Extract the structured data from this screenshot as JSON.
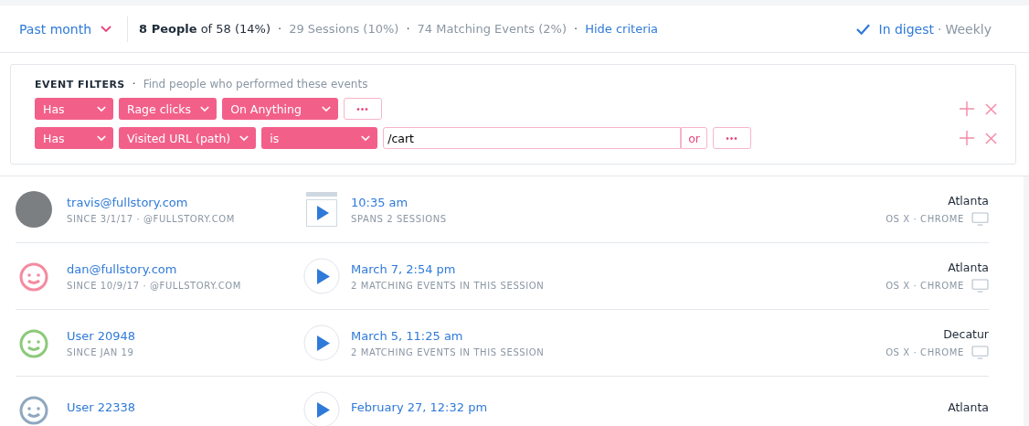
{
  "header": {
    "range": "Past month",
    "summary": [
      {
        "kind": "strong",
        "bold": "8 People",
        "rest": " of 58 (14%)"
      },
      {
        "kind": "muted",
        "text": "29 Sessions (10%)"
      },
      {
        "kind": "muted",
        "text": "74 Matching Events (2%)"
      },
      {
        "kind": "link",
        "text": "Hide criteria"
      }
    ],
    "separator": "·",
    "digest": {
      "checked": true,
      "label": "In digest",
      "sep": "·",
      "frequency": "Weekly"
    }
  },
  "filters": {
    "title": "EVENT FILTERS",
    "sep": "·",
    "subtitle": "Find people who performed these events",
    "rows": [
      {
        "items": [
          {
            "kind": "dropdown",
            "label": "Has"
          },
          {
            "kind": "dropdown",
            "label": "Rage clicks"
          },
          {
            "kind": "dropdown",
            "label": "On Anything"
          },
          {
            "kind": "more",
            "label": "•••"
          }
        ]
      },
      {
        "items": [
          {
            "kind": "dropdown",
            "label": "Has"
          },
          {
            "kind": "dropdown",
            "label": "Visited URL (path)"
          },
          {
            "kind": "dropdown",
            "label": "is"
          },
          {
            "kind": "input",
            "value": "/cart"
          },
          {
            "kind": "or",
            "label": "or"
          },
          {
            "kind": "more",
            "label": "•••"
          }
        ]
      }
    ]
  },
  "people": [
    {
      "avatar": {
        "kind": "photo"
      },
      "name": "travis@fullstory.com",
      "meta": "SINCE 3/1/17 · @FULLSTORY.COM",
      "session": {
        "kind": "clip"
      },
      "time": "10:35 am",
      "detail": "SPANS 2 SESSIONS",
      "city": "Atlanta",
      "device": "OS X · CHROME"
    },
    {
      "avatar": {
        "kind": "face"
      },
      "color": "#f48aa0",
      "name": "dan@fullstory.com",
      "meta": "SINCE 10/9/17 · @FULLSTORY.COM",
      "session": {
        "kind": "play"
      },
      "time": "March 7, 2:54 pm",
      "detail": "2 MATCHING EVENTS IN THIS SESSION",
      "city": "Atlanta",
      "device": "OS X · CHROME"
    },
    {
      "avatar": {
        "kind": "face"
      },
      "color": "#8dc97b",
      "name": "User 20948",
      "meta": "SINCE JAN 19",
      "session": {
        "kind": "play"
      },
      "time": "March 5, 11:25 am",
      "detail": "2 MATCHING EVENTS IN THIS SESSION",
      "city": "Decatur",
      "device": "OS X · CHROME"
    },
    {
      "avatar": {
        "kind": "face"
      },
      "color": "#8fa8bf",
      "name": "User 22338",
      "session": {
        "kind": "play"
      },
      "time": "February 27, 12:32 pm",
      "city": "Atlanta"
    }
  ]
}
